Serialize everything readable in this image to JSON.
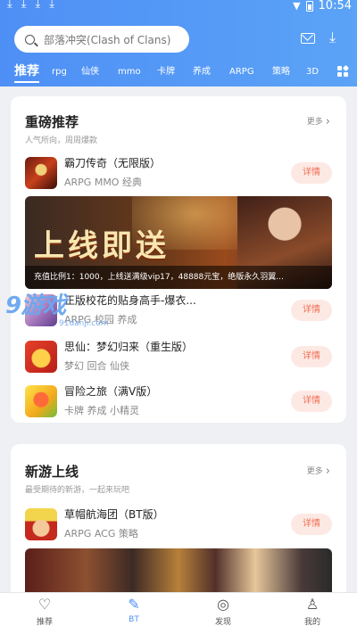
{
  "status": {
    "time": "10:54"
  },
  "search": {
    "placeholder": "部落冲突(Clash of Clans)"
  },
  "tabs": [
    "推荐",
    "rpg",
    "仙侠",
    "mmo",
    "卡牌",
    "养成",
    "ARPG",
    "策略",
    "3D"
  ],
  "section1": {
    "title": "重磅推荐",
    "subtitle": "人气所向，周周爆款",
    "more": "更多",
    "games": [
      {
        "name": "霸刀传奇（无限版）",
        "tags": "ARPG MMO 经典",
        "button": "详情",
        "icon": "badao-icon"
      },
      {
        "name": "正版校花的贴身高手-爆衣...",
        "tags": "ARPG 校园 养成",
        "button": "详情",
        "icon": "xiaohua-icon"
      },
      {
        "name": "思仙：梦幻归来（重生版）",
        "tags": "梦幻 回合 仙侠",
        "button": "详情",
        "icon": "sixian-icon"
      },
      {
        "name": "冒险之旅（满V版）",
        "tags": "卡牌 养成 小精灵",
        "button": "详情",
        "icon": "maoxian-icon"
      }
    ],
    "banner": {
      "headline": "上线即送",
      "caption": "充值比例1：1000，上线送满级vip17，48888元宝，绝版永久羽翼..."
    }
  },
  "section2": {
    "title": "新游上线",
    "subtitle": "最受期待的新游，一起来玩吧",
    "more": "更多",
    "games": [
      {
        "name": "草帽航海团（BT版）",
        "tags": "ARPG ACG 策略",
        "button": "详情",
        "icon": "onepiece-icon"
      }
    ]
  },
  "watermark": {
    "brand": "9游戏",
    "site": "91danji.com"
  },
  "nav": [
    {
      "label": "推荐",
      "icon": "heart-icon",
      "active": false
    },
    {
      "label": "BT",
      "icon": "bt-icon",
      "active": true
    },
    {
      "label": "发现",
      "icon": "discover-icon",
      "active": false
    },
    {
      "label": "我的",
      "icon": "user-icon",
      "active": false
    }
  ],
  "colors": {
    "accent": "#4e8ff5",
    "detail_bg": "#fde9e4",
    "detail_text": "#ef6f52"
  }
}
